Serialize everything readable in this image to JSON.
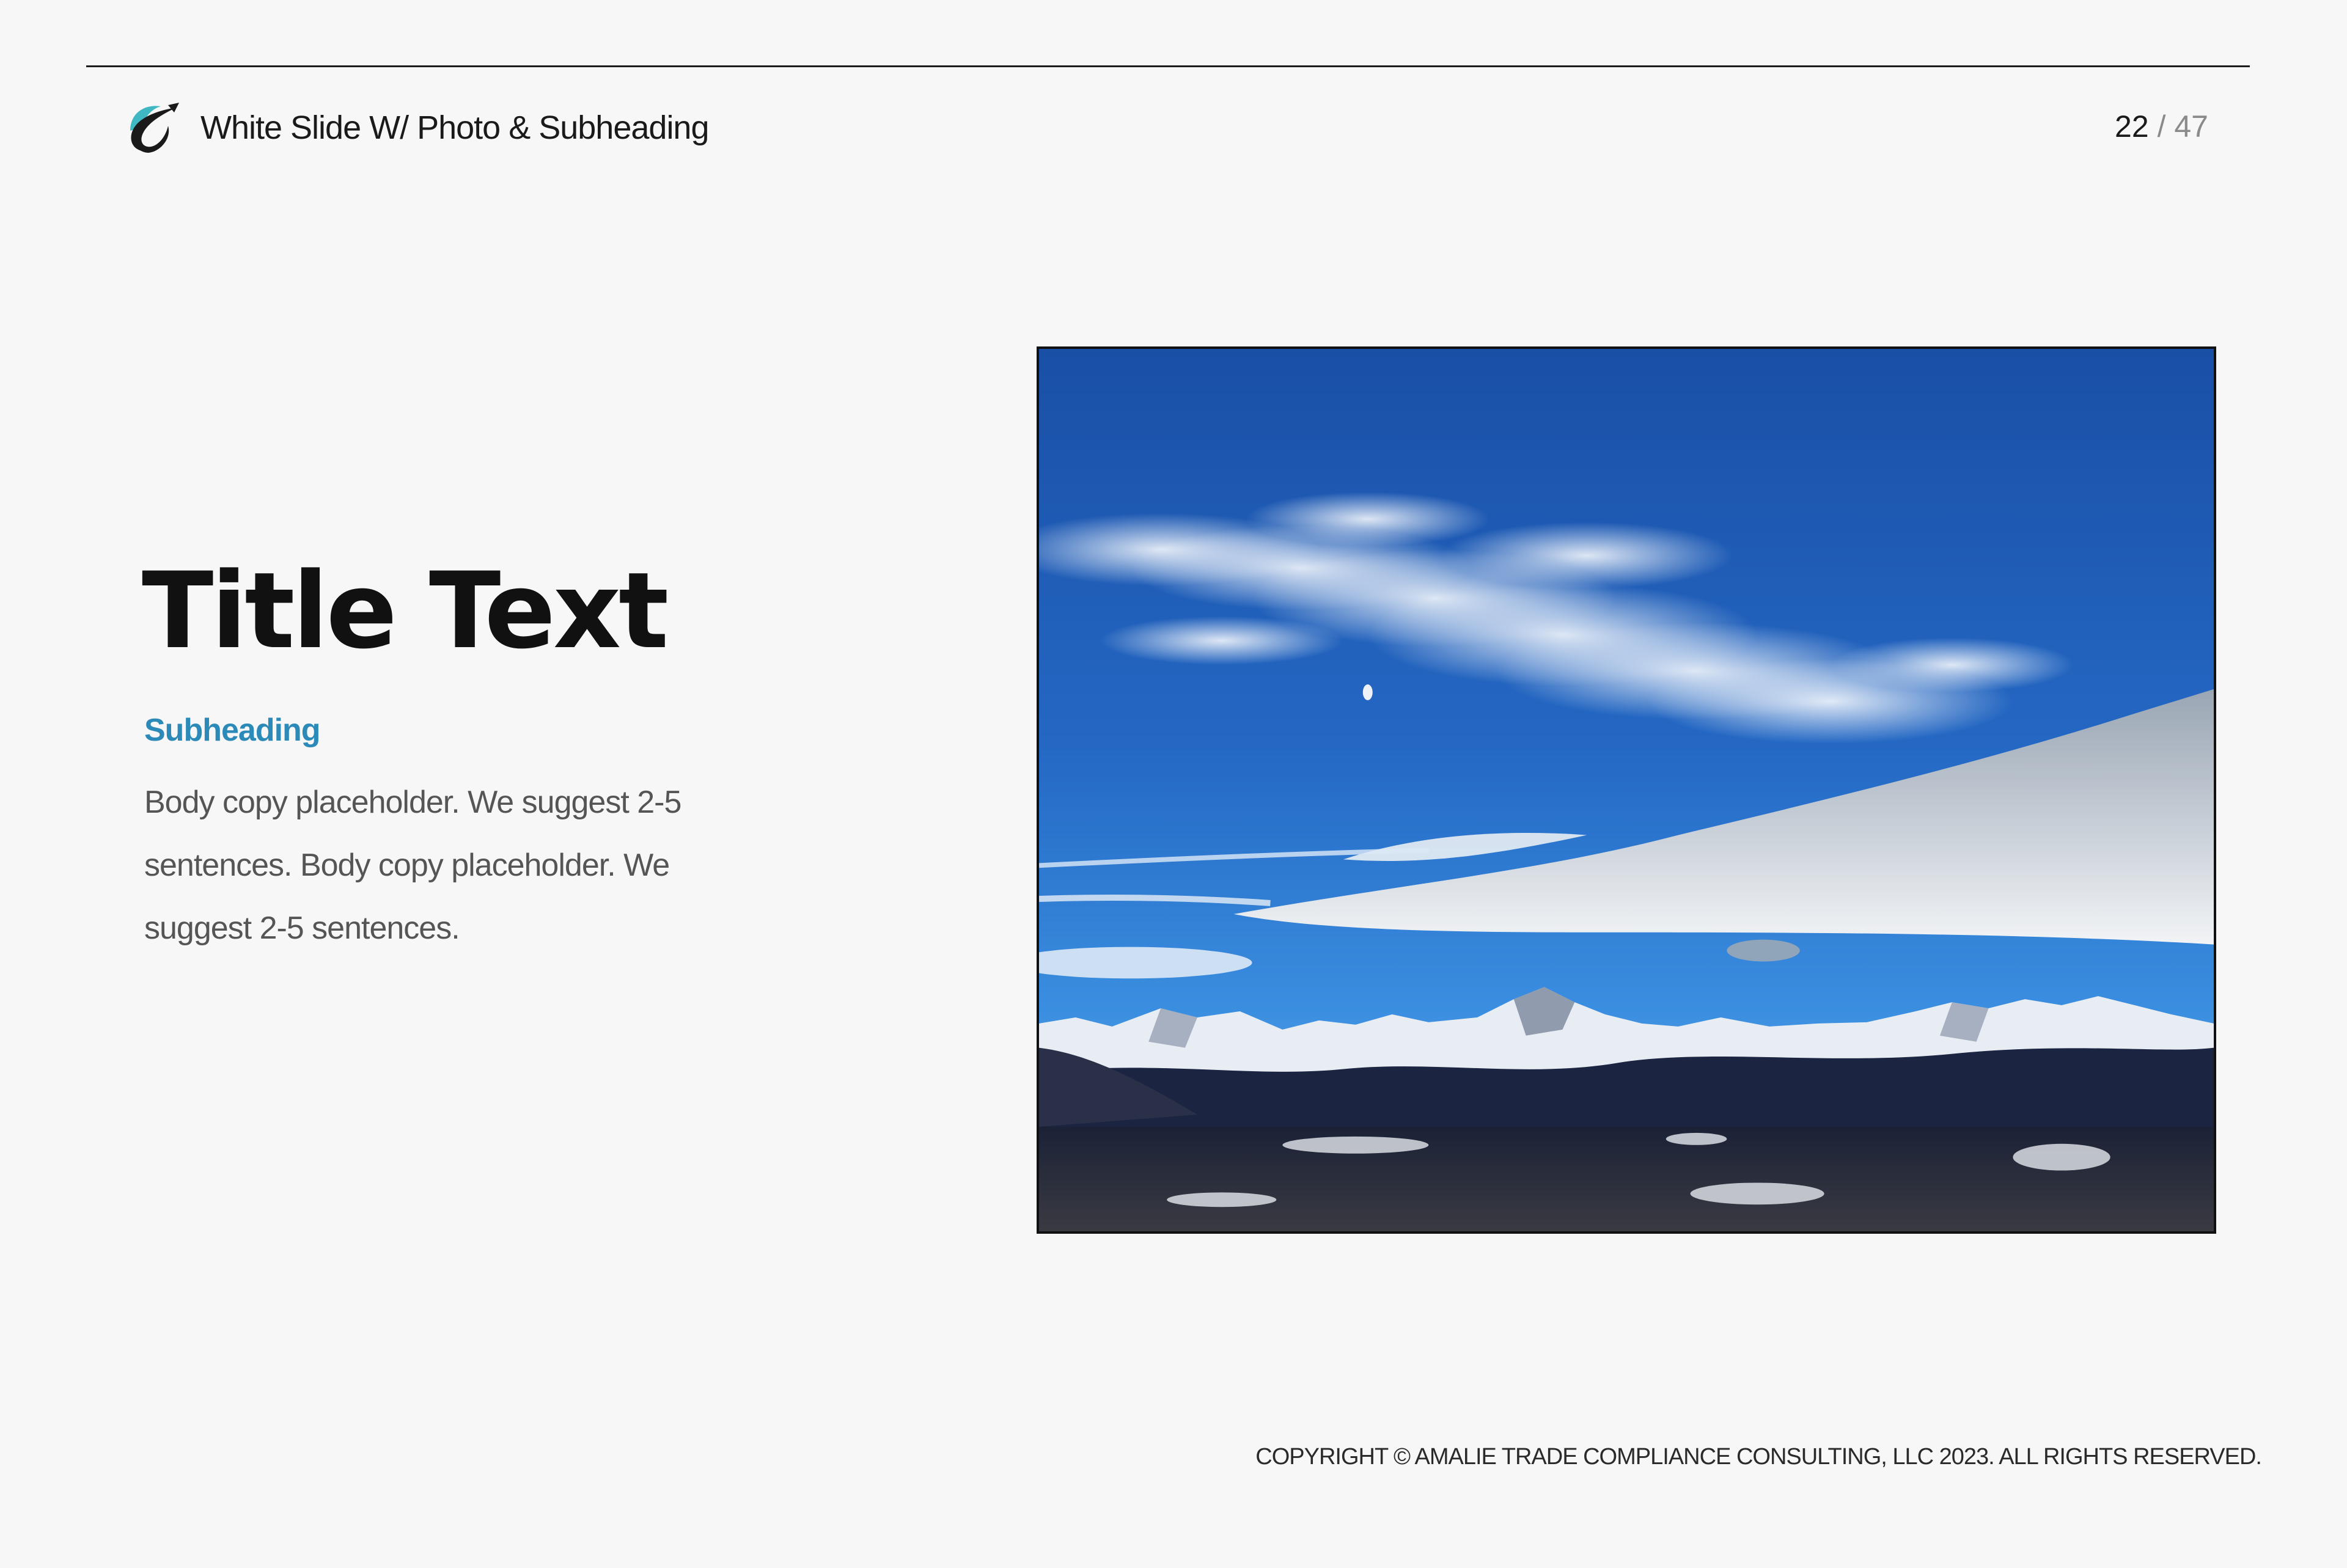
{
  "header": {
    "logo_icon": "company-swoosh-logo-icon",
    "title": "White Slide W/ Photo & Subheading",
    "page_current": "22",
    "page_separator": "/",
    "page_total": "47"
  },
  "content": {
    "title": "Title Text",
    "subheading": "Subheading",
    "body": "Body copy placeholder. We suggest 2-5 sentences. Body copy placeholder. We suggest 2-5 sentences."
  },
  "photo": {
    "subject": "mountain-landscape-photo"
  },
  "footer": {
    "copyright": "COPYRIGHT © AMALIE TRADE COMPLIANCE CONSULTING, LLC 2023.  ALL RIGHTS RESERVED."
  },
  "colors": {
    "background": "#f7f7f7",
    "accent": "#2b8ab8",
    "logo_teal": "#3fb8c4",
    "title": "#111111",
    "body": "#555555"
  }
}
